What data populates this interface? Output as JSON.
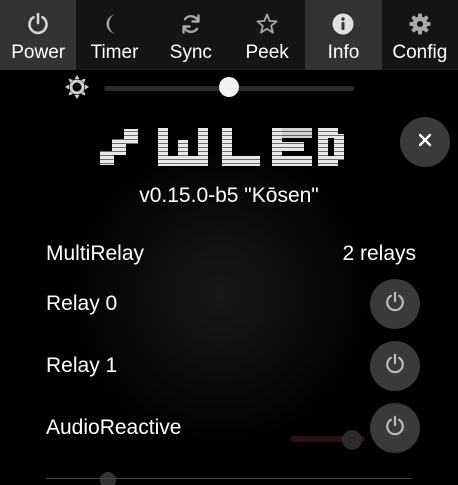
{
  "tabs": [
    {
      "label": "Power",
      "icon": "power-icon",
      "active": true
    },
    {
      "label": "Timer",
      "icon": "moon-icon",
      "active": false
    },
    {
      "label": "Sync",
      "icon": "sync-icon",
      "active": false
    },
    {
      "label": "Peek",
      "icon": "star-icon",
      "active": false
    },
    {
      "label": "Info",
      "icon": "info-icon",
      "active": true
    },
    {
      "label": "Config",
      "icon": "gear-icon",
      "active": false
    }
  ],
  "brightness": {
    "icon": "brightness-icon",
    "level": 0.5
  },
  "info": {
    "logo_text": "WLED",
    "version": "v0.15.0-b5 \"Kōsen\"",
    "multirelay": {
      "label": "MultiRelay",
      "value": "2 relays"
    },
    "usermods": [
      {
        "label": "Relay 0"
      },
      {
        "label": "Relay 1"
      },
      {
        "label": "AudioReactive"
      }
    ]
  },
  "colors": {
    "background": "#000000",
    "tab_bar": "#151515",
    "tab_active": "#333333",
    "button": "#3a3a3a",
    "icon": "#bbbbbb",
    "text": "#ffffff"
  }
}
